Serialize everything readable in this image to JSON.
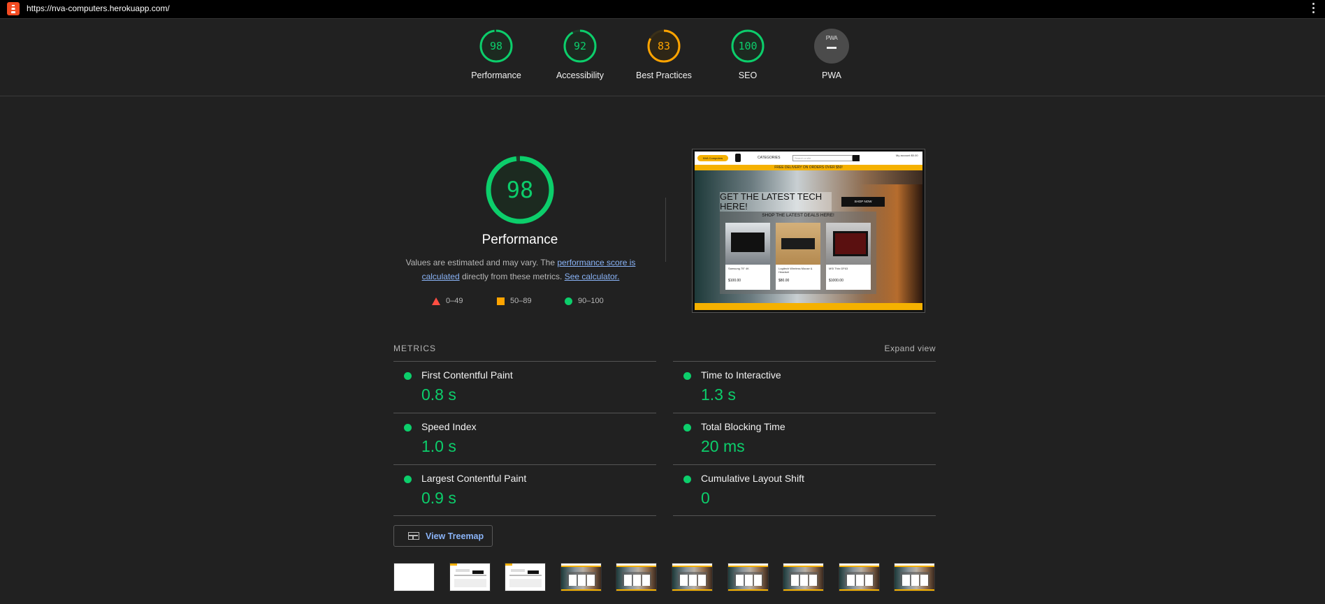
{
  "browser": {
    "url": "https://nva-computers.herokuapp.com/",
    "menu_icon": "kebab-menu-icon",
    "site_icon": "lighthouse-icon"
  },
  "summary": [
    {
      "label": "Performance",
      "score": "98",
      "value": 98,
      "color": "#0cce6b"
    },
    {
      "label": "Accessibility",
      "score": "92",
      "value": 92,
      "color": "#0cce6b"
    },
    {
      "label": "Best Practices",
      "score": "83",
      "value": 83,
      "color": "#ffa400"
    },
    {
      "label": "SEO",
      "score": "100",
      "value": 100,
      "color": "#0cce6b"
    },
    {
      "label": "PWA",
      "badge": "PWA",
      "color": "#4b4b4b"
    }
  ],
  "performance": {
    "score": "98",
    "value": 98,
    "title": "Performance",
    "desc_prefix": "Values are estimated and may vary. The ",
    "desc_link1": "performance score is calculated",
    "desc_middle": " directly from these metrics. ",
    "desc_link2": "See calculator."
  },
  "scale": [
    {
      "range": "0–49",
      "shape": "triangle",
      "color": "#ff4e42"
    },
    {
      "range": "50–89",
      "shape": "square",
      "color": "#ffa400"
    },
    {
      "range": "90–100",
      "shape": "circle",
      "color": "#0cce6b"
    }
  ],
  "screenshot": {
    "logo": "NVA Computers",
    "categories": "CATEGORIES",
    "search_placeholder": "Search a site",
    "account": "My account",
    "bag": "$0.00",
    "strip": "FREE DELIVERY ON ORDERS OVER $50!",
    "headline": "GET THE LATEST TECH HERE!",
    "shop_now": "SHOP NOW",
    "deals": "SHOP THE LATEST DEALS HERE!",
    "cards": [
      {
        "name": "Samsung 75\" 4K",
        "price": "$100.00"
      },
      {
        "name": "Logitech Wireless Mouse & Headset",
        "price": "$80.00"
      },
      {
        "name": "MSI Thin GF63",
        "price": "$1000.00"
      }
    ]
  },
  "metrics": {
    "title": "METRICS",
    "expand": "Expand view",
    "items": [
      {
        "name": "First Contentful Paint",
        "value": "0.8 s"
      },
      {
        "name": "Time to Interactive",
        "value": "1.3 s"
      },
      {
        "name": "Speed Index",
        "value": "1.0 s"
      },
      {
        "name": "Total Blocking Time",
        "value": "20 ms"
      },
      {
        "name": "Largest Contentful Paint",
        "value": "0.9 s"
      },
      {
        "name": "Cumulative Layout Shift",
        "value": "0"
      }
    ],
    "status_color": "#0cce6b"
  },
  "treemap": {
    "label": "View Treemap",
    "icon": "treemap-icon"
  },
  "filmstrip": {
    "frames": 10
  }
}
